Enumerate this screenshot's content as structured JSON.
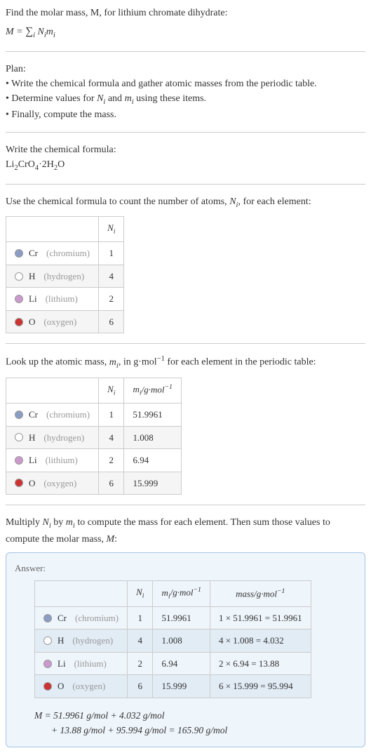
{
  "intro": {
    "line1": "Find the molar mass, M, for lithium chromate dihydrate:",
    "formula": "M = ∑ᵢ Nᵢmᵢ"
  },
  "plan": {
    "heading": "Plan:",
    "b1": "• Write the chemical formula and gather atomic masses from the periodic table.",
    "b2": "• Determine values for Nᵢ and mᵢ using these items.",
    "b3": "• Finally, compute the mass."
  },
  "chemFormula": {
    "heading": "Write the chemical formula:",
    "value": "Li₂CrO₄·2H₂O"
  },
  "countAtoms": {
    "heading_a": "Use the chemical formula to count the number of atoms, ",
    "heading_b": "Nᵢ",
    "heading_c": ", for each element:"
  },
  "lookup": {
    "heading_a": "Look up the atomic mass, ",
    "heading_b": "mᵢ",
    "heading_c": ", in g·mol⁻¹ for each element in the periodic table:"
  },
  "multiply": {
    "heading": "Multiply Nᵢ by mᵢ to compute the mass for each element. Then sum those values to compute the molar mass, M:"
  },
  "headers": {
    "ni": "Nᵢ",
    "mi": "mᵢ/g·mol⁻¹",
    "mass": "mass/g·mol⁻¹"
  },
  "elements": [
    {
      "sym": "Cr",
      "name": "(chromium)",
      "color": "#8b9dc3",
      "ni": "1",
      "mi": "51.9961",
      "mass": "1 × 51.9961 = 51.9961"
    },
    {
      "sym": "H",
      "name": "(hydrogen)",
      "color": "#ffffff",
      "ni": "4",
      "mi": "1.008",
      "mass": "4 × 1.008 = 4.032"
    },
    {
      "sym": "Li",
      "name": "(lithium)",
      "color": "#cc99cc",
      "ni": "2",
      "mi": "6.94",
      "mass": "2 × 6.94 = 13.88"
    },
    {
      "sym": "O",
      "name": "(oxygen)",
      "color": "#cc3333",
      "ni": "6",
      "mi": "15.999",
      "mass": "6 × 15.999 = 95.994"
    }
  ],
  "answer": {
    "label": "Answer:",
    "calc1": "M = 51.9961 g/mol + 4.032 g/mol",
    "calc2": "+ 13.88 g/mol + 95.994 g/mol = 165.90 g/mol"
  }
}
